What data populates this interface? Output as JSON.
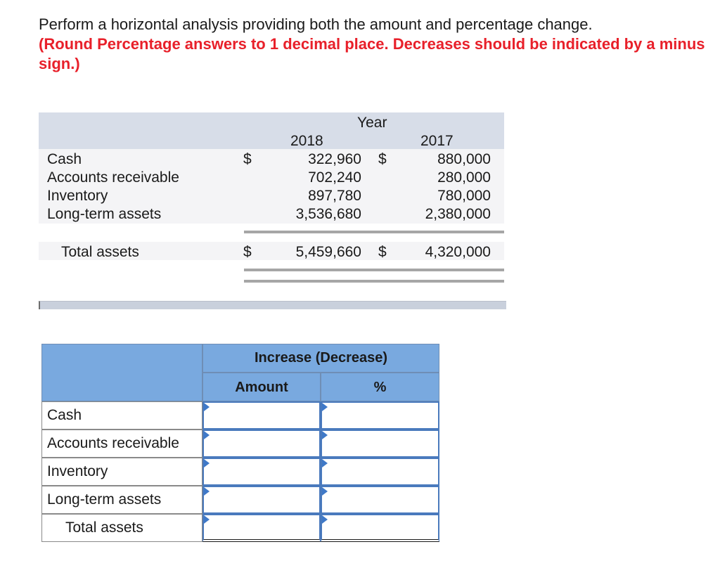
{
  "instructions": {
    "text": "Perform a horizontal analysis providing both the amount and percentage change.",
    "note": "(Round Percentage answers to 1 decimal place. Decreases should be indicated by a minus sign.)"
  },
  "data_table": {
    "header": "Year",
    "years": [
      "2018",
      "2017"
    ],
    "currency": "$",
    "rows": [
      {
        "label": "Cash",
        "y2018": "322,960",
        "y2017": "880,000"
      },
      {
        "label": "Accounts receivable",
        "y2018": "702,240",
        "y2017": "280,000"
      },
      {
        "label": "Inventory",
        "y2018": "897,780",
        "y2017": "780,000"
      },
      {
        "label": "Long-term assets",
        "y2018": "3,536,680",
        "y2017": "2,380,000"
      }
    ],
    "total": {
      "label": "Total assets",
      "y2018": "5,459,660",
      "y2017": "4,320,000"
    }
  },
  "answer_grid": {
    "group_header": "Increase (Decrease)",
    "col_amount": "Amount",
    "col_percent": "%",
    "rows": [
      "Cash",
      "Accounts receivable",
      "Inventory",
      "Long-term assets",
      "Total assets"
    ]
  },
  "colors": {
    "instruction_red": "#e8202a",
    "header_blue": "#79a9df",
    "input_border": "#4a7abd"
  }
}
